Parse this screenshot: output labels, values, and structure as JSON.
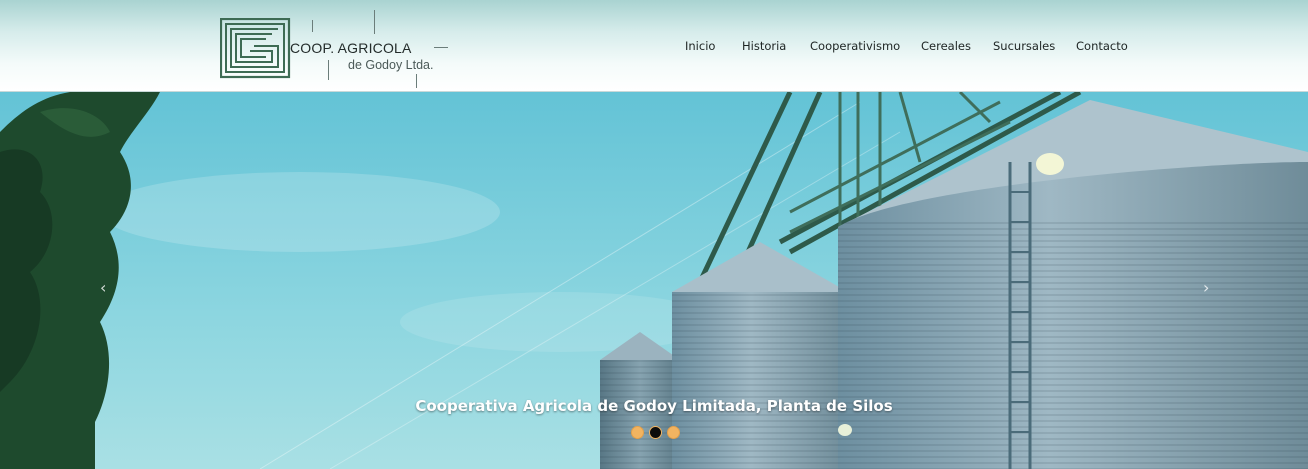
{
  "brand": {
    "title": "COOP. AGRICOLA",
    "subtitle": "de Godoy Ltda.",
    "color": "#3e6b54"
  },
  "nav": {
    "items": [
      {
        "label": "Inicio"
      },
      {
        "label": "Historia"
      },
      {
        "label": "Cooperativismo"
      },
      {
        "label": "Cereales"
      },
      {
        "label": "Sucursales"
      },
      {
        "label": "Contacto"
      }
    ]
  },
  "slider": {
    "caption": "Cooperativa Agricola de Godoy Limitada, Planta de Silos",
    "total_slides": 3,
    "active_slide": 2,
    "prev_icon": "chevron-left-icon",
    "next_icon": "chevron-right-icon",
    "prev_glyph": "‹",
    "next_glyph": "›",
    "dot_color": "#f2b461",
    "active_dot_color": "#0c0c0c"
  }
}
